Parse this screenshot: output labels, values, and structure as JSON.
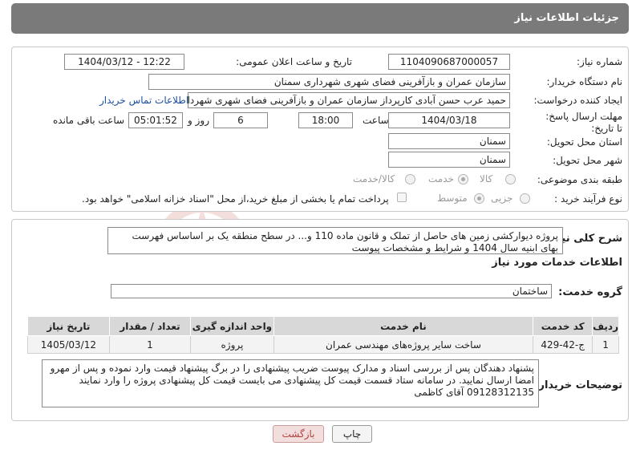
{
  "header": {
    "title": "جزئیات اطلاعات نیاز"
  },
  "fields": {
    "need_number": {
      "label": "شماره نیاز:",
      "value": "1104090687000057"
    },
    "announce_datetime": {
      "label": "تاریخ و ساعت اعلان عمومی:",
      "value": "1404/03/12 - 12:22"
    },
    "buyer_org": {
      "label": "نام دستگاه خریدار:",
      "value": "سازمان عمران و بازآفرینی فضای شهری شهرداری سمنان"
    },
    "requester": {
      "label": "ایجاد کننده درخواست:",
      "value": "حمید عرب حسن آبادی کارپرداز سازمان عمران و بازآفرینی فضای شهری شهردار",
      "contact_link": "اطلاعات تماس خریدار"
    },
    "deadline": {
      "label": "مهلت ارسال پاسخ: تا تاریخ:",
      "date": "1404/03/18",
      "time_label": "ساعت",
      "time": "18:00",
      "days": "6",
      "days_label": "روز و",
      "remaining": "05:01:52",
      "remaining_label": "ساعت باقی مانده"
    },
    "delivery_province": {
      "label": "استان محل تحویل:",
      "value": "سمنان"
    },
    "delivery_city": {
      "label": "شهر محل تحویل:",
      "value": "سمنان"
    },
    "category": {
      "label": "طبقه بندی موضوعی:",
      "options": [
        "کالا",
        "خدمت",
        "کالا/خدمت"
      ],
      "selected": "خدمت"
    },
    "process_type": {
      "label": "نوع فرآیند خرید :",
      "options": [
        "جزیی",
        "متوسط"
      ],
      "selected": "متوسط",
      "payment_note": "پرداخت تمام یا بخشی از مبلغ خرید،از محل \"اسناد خزانه اسلامی\" خواهد بود."
    }
  },
  "summary": {
    "label": "شرح کلی نیاز:",
    "text": "پروژه دیوارکشی زمین های حاصل از تملک و قانون ماده 110 و... در سطح منطقه یک بر اساساس فهرست بهای ابنیه سال 1404 و شرایط و مشخصات پیوست"
  },
  "services": {
    "section_title": "اطلاعات خدمات مورد نیاز",
    "group_label": "گروه خدمت:",
    "group_value": "ساختمان",
    "columns": [
      "ردیف",
      "کد خدمت",
      "نام خدمت",
      "واحد اندازه گیری",
      "تعداد / مقدار",
      "تاریخ نیاز"
    ],
    "rows": [
      [
        "1",
        "ج-42-429",
        "ساخت سایر پروژه‌های مهندسی عمران",
        "پروژه",
        "1",
        "1405/03/12"
      ]
    ]
  },
  "buyer_notes": {
    "label": "توضیحات خریدار:",
    "text": "پشنهاد دهندگان پس از بررسی اسناد و مدارک پیوست ضریب پیشنهادی را در برگ پیشنهاد قیمت وارد نموده و پس از مهرو امضا ارسال نمایید. در سامانه ستاد قسمت قیمت کل پیشنهادی می بایست قیمت کل پیشنهادی پروژه را وارد نمایند 09128312135 آقای کاظمی"
  },
  "buttons": {
    "print": "چاپ",
    "back": "بازگشت"
  },
  "watermark_text": "AriaTender.neT",
  "colors": {
    "header_bg": "#7a7a7a",
    "link": "#1a4fa0",
    "back_button_bg": "#f3dede",
    "watermark": "#c0392b"
  }
}
